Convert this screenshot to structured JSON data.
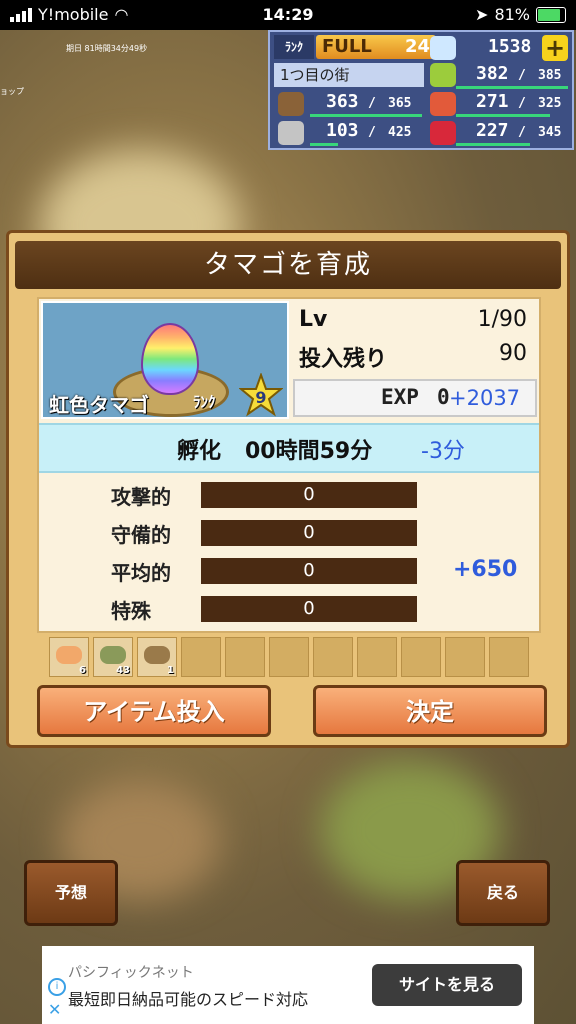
{
  "status_bar": {
    "carrier": "Y!mobile",
    "time": "14:29",
    "battery": "81%"
  },
  "overlay": {
    "duration": "期日 81時間34分49秒",
    "side_text": "ョップ"
  },
  "resources": {
    "rank_label": "ﾗﾝｸ",
    "rank_full": "FULL",
    "rank_value": "24",
    "gems": "1538",
    "town": "1つ目の街",
    "grass": {
      "value": "382",
      "max": "385"
    },
    "wood": {
      "value": "363",
      "max": "365"
    },
    "food": {
      "value": "271",
      "max": "325"
    },
    "ore": {
      "value": "103",
      "max": "425"
    },
    "ruby": {
      "value": "227",
      "max": "345"
    },
    "separator": "/"
  },
  "dialog": {
    "title": "タマゴを育成",
    "egg_name": "虹色タマゴ",
    "rank_text": "ﾗﾝｸ",
    "rank_star": "9",
    "lv_label": "Lv",
    "lv_value": "1/90",
    "remaining_label": "投入残り",
    "remaining_value": "90",
    "exp_label": "EXP",
    "exp_value": "0",
    "exp_plus": "+2037",
    "hatch_label": "孵化",
    "hatch_time": "00時間59分",
    "hatch_delta": "-3分",
    "stats": [
      {
        "name": "攻撃的",
        "value": "0",
        "bonus": ""
      },
      {
        "name": "守備的",
        "value": "0",
        "bonus": ""
      },
      {
        "name": "平均的",
        "value": "0",
        "bonus": "+650"
      },
      {
        "name": "特殊",
        "value": "0",
        "bonus": ""
      }
    ],
    "items": [
      {
        "name": "fish-item",
        "count": "6",
        "color": "#f2a86a"
      },
      {
        "name": "bag-item",
        "count": "43",
        "color": "#8a9a5a"
      },
      {
        "name": "basket-item",
        "count": "1",
        "color": "#9a7a4a"
      }
    ],
    "insert_button": "アイテム投入",
    "confirm_button": "決定"
  },
  "nav": {
    "predict": "予想",
    "back": "戻る"
  },
  "ad": {
    "brand": "パシフィックネット",
    "text": "最短即日納品可能のスピード対応",
    "cta": "サイトを見る",
    "info": "i",
    "close": "✕"
  }
}
